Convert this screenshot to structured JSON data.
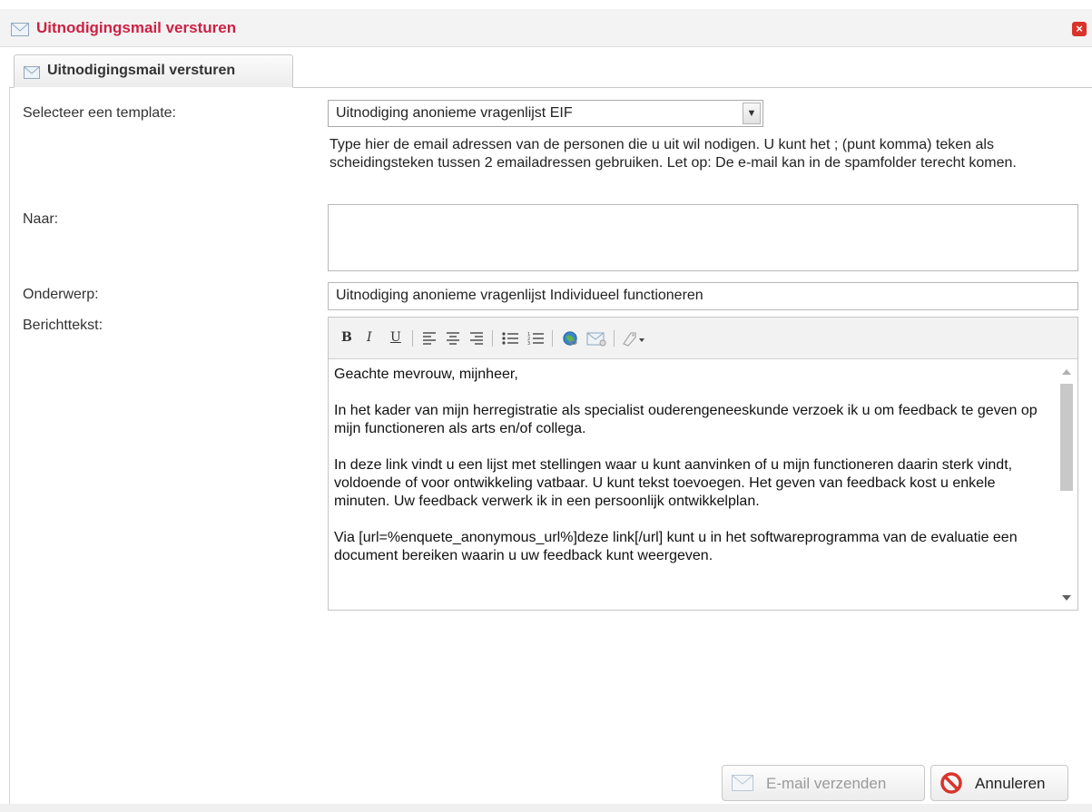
{
  "window": {
    "title": "Uitnodigingsmail versturen",
    "close_label": "×"
  },
  "tabs": [
    {
      "label": "Uitnodigingsmail versturen",
      "active": true
    }
  ],
  "form": {
    "template_label": "Selecteer een template:",
    "template_value": "Uitnodiging anonieme vragenlijst EIF",
    "hint": "Type hier de email adressen van de personen die u uit wil nodigen. U kunt het ; (punt komma) teken als scheidingsteken tussen 2 emailadressen gebruiken. Let op: De e-mail kan in de spamfolder terecht komen.",
    "to_label": "Naar:",
    "to_value": "",
    "subject_label": "Onderwerp:",
    "subject_value": "Uitnodiging anonieme vragenlijst Individueel functioneren",
    "body_label": "Berichttekst:"
  },
  "editor": {
    "toolbar": {
      "bold": "B",
      "italic": "I",
      "underline": "U",
      "icons": [
        "align-left-icon",
        "align-center-icon",
        "align-right-icon",
        "bulleted-list-icon",
        "numbered-list-icon",
        "link-globe-icon",
        "email-icon",
        "tag-dropdown-icon"
      ]
    },
    "paragraphs": [
      "Geachte mevrouw, mijnheer,",
      "In het kader van mijn herregistratie als specialist ouderengeneeskunde verzoek ik u om feedback te geven op mijn functioneren als arts en/of collega.",
      "In deze link vindt u een lijst met stellingen waar u kunt aanvinken of u mijn functioneren daarin sterk vindt, voldoende of voor ontwikkeling vatbaar. U kunt tekst toevoegen. Het geven van feedback kost u enkele minuten. Uw feedback verwerk ik in een persoonlijk ontwikkelplan.",
      "Via  [url=%enquete_anonymous_url%]deze link[/url] kunt u in het softwareprogramma van de evaluatie een document bereiken waarin u uw feedback kunt weergeven."
    ]
  },
  "buttons": {
    "send": "E-mail verzenden",
    "cancel": "Annuleren"
  },
  "colors": {
    "title": "#cc2244",
    "cancel_icon": "#d9342b"
  }
}
